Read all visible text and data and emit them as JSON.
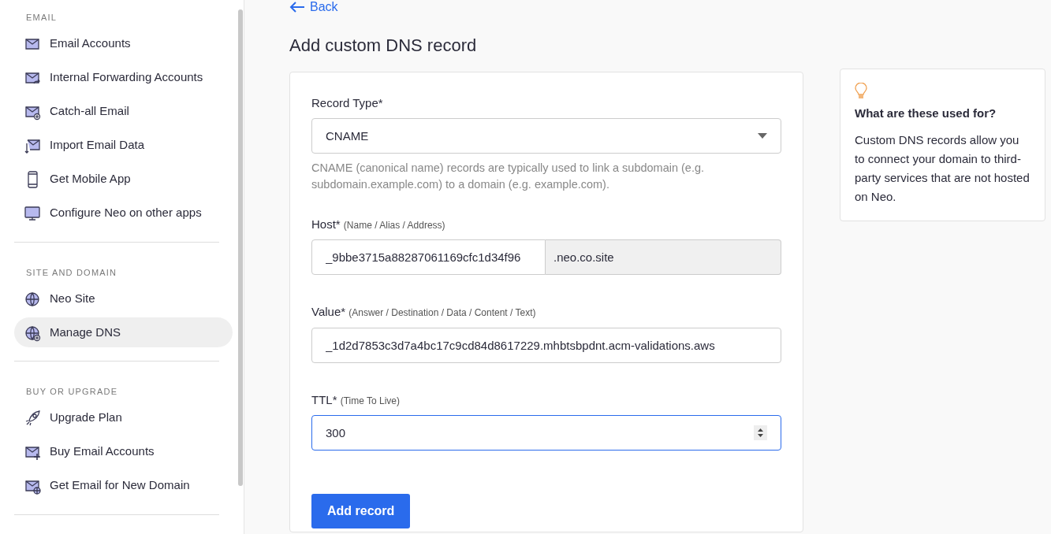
{
  "sidebar": {
    "sections": [
      {
        "heading": "EMAIL",
        "items": [
          {
            "label": "Email Accounts",
            "selected": false
          },
          {
            "label": "Internal Forwarding Accounts",
            "selected": false
          },
          {
            "label": "Catch-all Email",
            "selected": false
          },
          {
            "label": "Import Email Data",
            "selected": false
          },
          {
            "label": "Get Mobile App",
            "selected": false
          },
          {
            "label": "Configure Neo on other apps",
            "selected": false
          }
        ]
      },
      {
        "heading": "SITE AND DOMAIN",
        "items": [
          {
            "label": "Neo Site",
            "selected": false
          },
          {
            "label": "Manage DNS",
            "selected": true
          }
        ]
      },
      {
        "heading": "BUY OR UPGRADE",
        "items": [
          {
            "label": "Upgrade Plan",
            "selected": false
          },
          {
            "label": "Buy Email Accounts",
            "selected": false
          },
          {
            "label": "Get Email for New Domain",
            "selected": false
          }
        ]
      }
    ]
  },
  "back_link": "Back",
  "title": "Add custom DNS record",
  "form": {
    "record_type": {
      "label": "Record Type*",
      "value": "CNAME",
      "help": "CNAME (canonical name) records are typically used to link a subdomain (e.g. subdomain.example.com) to a domain (e.g. example.com)."
    },
    "host": {
      "label": "Host*",
      "hint": "(Name / Alias / Address)",
      "value": "_9bbe3715a88287061169cfc1d34f96",
      "suffix": ".neo.co.site"
    },
    "value": {
      "label": "Value*",
      "hint": "(Answer / Destination / Data / Content / Text)",
      "value": "_1d2d7853c3d7a4bc17c9cd84d8617229.mhbtsbpdnt.acm-validations.aws"
    },
    "ttl": {
      "label": "TTL*",
      "hint": "(Time To Live)",
      "value": "300",
      "focused": true
    },
    "submit": "Add record"
  },
  "info": {
    "title": "What are these used for?",
    "text": "Custom DNS records allow you to connect your domain to third-party services that are not hosted on Neo."
  }
}
